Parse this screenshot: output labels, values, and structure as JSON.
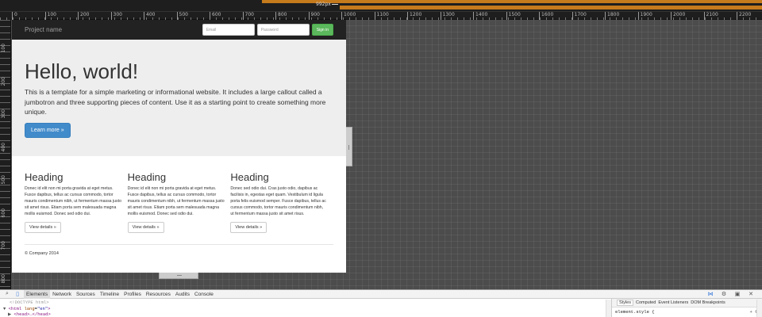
{
  "ruler": {
    "width_indicator": "992px",
    "ticks": [
      "0",
      "100",
      "200",
      "300",
      "400",
      "500",
      "600",
      "700",
      "800",
      "900",
      "1000",
      "1100",
      "1200",
      "1300",
      "1400",
      "1500",
      "1600",
      "1700",
      "1800",
      "1900",
      "2000",
      "2100",
      "2200"
    ],
    "vticks": [
      "100",
      "200",
      "300",
      "400",
      "500",
      "600",
      "700",
      "800"
    ]
  },
  "site": {
    "brand": "Project name",
    "email_placeholder": "Email",
    "password_placeholder": "Password",
    "signin_label": "Sign in",
    "jumbotron": {
      "title": "Hello, world!",
      "text": "This is a template for a simple marketing or informational website. It includes a large callout called a jumbotron and three supporting pieces of content. Use it as a starting point to create something more unique.",
      "button": "Learn more »"
    },
    "columns": [
      {
        "heading": "Heading",
        "text": "Donec id elit non mi porta gravida at eget metus. Fusce dapibus, tellus ac cursus commodo, tortor mauris condimentum nibh, ut fermentum massa justo sit amet risus. Etiam porta sem malesuada magna mollis euismod. Donec sed odio dui.",
        "button": "View details »"
      },
      {
        "heading": "Heading",
        "text": "Donec id elit non mi porta gravida at eget metus. Fusce dapibus, tellus ac cursus commodo, tortor mauris condimentum nibh, ut fermentum massa justo sit amet risus. Etiam porta sem malesuada magna mollis euismod. Donec sed odio dui.",
        "button": "View details »"
      },
      {
        "heading": "Heading",
        "text": "Donec sed odio dui. Cras justo odio, dapibus ac facilisis in, egestas eget quam. Vestibulum id ligula porta felis euismod semper. Fusce dapibus, tellus ac cursus commodo, tortor mauris condimentum nibh, ut fermentum massa justo sit amet risus.",
        "button": "View details »"
      }
    ],
    "footer": "© Company 2014"
  },
  "devtools": {
    "tabs": [
      "Elements",
      "Network",
      "Sources",
      "Timeline",
      "Profiles",
      "Resources",
      "Audits",
      "Console"
    ],
    "active_tab": "Elements",
    "code_lines": [
      "<!DOCTYPE html>",
      "html",
      "lang",
      "\"en\"",
      "head"
    ],
    "styles_tabs": [
      "Styles",
      "Computed",
      "Event Listeners",
      "DOM Breakpoints"
    ],
    "styles_rule": "element.style {",
    "styles_actions": "+ ⚙"
  },
  "colors": {
    "ruler_media": "#c57a1c",
    "navbar": "#222222",
    "primary": "#428bca",
    "success": "#5cb85c",
    "jumbotron": "#eeeeee"
  }
}
